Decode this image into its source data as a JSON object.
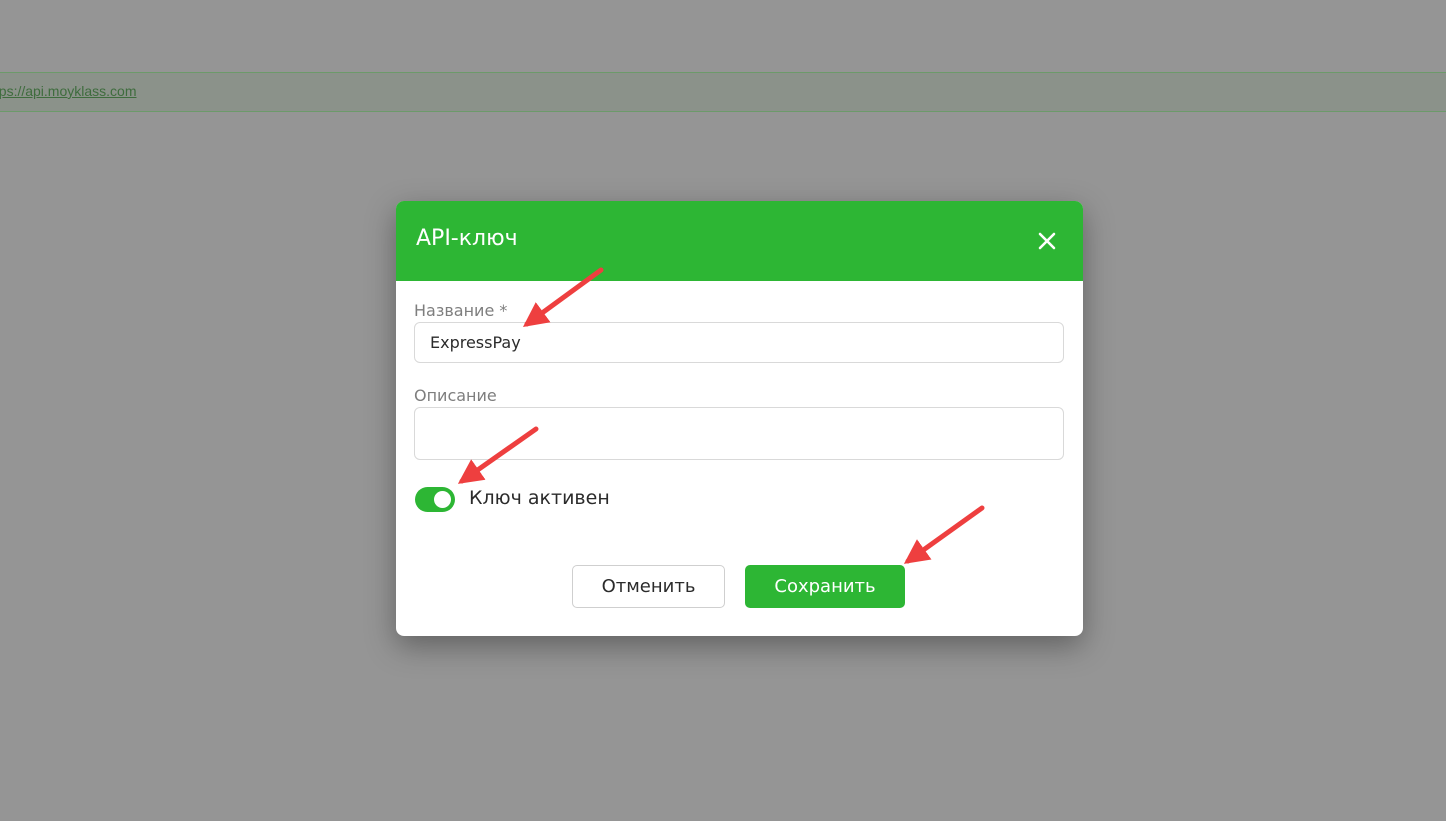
{
  "background": {
    "link_text": "ttps://api.moyklass.com"
  },
  "dialog": {
    "title": "API-ключ",
    "close_icon": "close-icon",
    "name_field": {
      "label": "Название *",
      "value": "ExpressPay"
    },
    "description_field": {
      "label": "Описание",
      "value": ""
    },
    "active_toggle": {
      "label": "Ключ активен",
      "checked": true
    },
    "cancel_label": "Отменить",
    "save_label": "Сохранить"
  },
  "colors": {
    "accent": "#2db634",
    "overlay": "#959595",
    "annotation_arrow": "#ee3f3f"
  }
}
